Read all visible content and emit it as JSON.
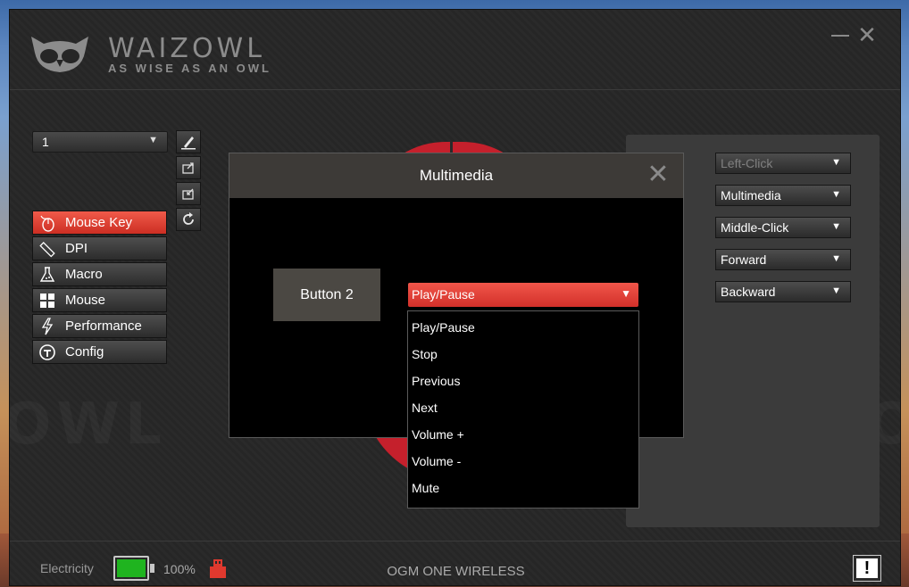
{
  "brand": {
    "name": "WAIZOWL",
    "tagline": "AS WISE AS AN OWL",
    "watermark": "OWL"
  },
  "window_controls": {
    "minimize": "minimize-icon",
    "close": "close-icon"
  },
  "profile": {
    "selected": "1"
  },
  "tools": [
    "pen-icon",
    "import-icon",
    "export-icon",
    "reset-icon"
  ],
  "nav": {
    "items": [
      {
        "label": "Mouse Key",
        "icon": "mouse-icon",
        "active": true
      },
      {
        "label": "DPI",
        "icon": "ruler-icon",
        "active": false
      },
      {
        "label": "Macro",
        "icon": "flask-icon",
        "active": false
      },
      {
        "label": "Mouse",
        "icon": "windows-icon",
        "active": false
      },
      {
        "label": "Performance",
        "icon": "lightning-icon",
        "active": false
      },
      {
        "label": "Config",
        "icon": "config-icon",
        "active": false
      }
    ]
  },
  "button_assignments": [
    {
      "value": "Left-Click",
      "disabled": true
    },
    {
      "value": "Multimedia",
      "disabled": false
    },
    {
      "value": "Middle-Click",
      "disabled": false
    },
    {
      "value": "Forward",
      "disabled": false
    },
    {
      "value": "Backward",
      "disabled": false
    }
  ],
  "modal": {
    "title": "Multimedia",
    "button_label": "Button 2",
    "selected": "Play/Pause",
    "options": [
      "Play/Pause",
      "Stop",
      "Previous",
      "Next",
      "Volume +",
      "Volume -",
      "Mute"
    ]
  },
  "footer": {
    "electricity_label": "Electricity",
    "battery_percent": "100%",
    "battery_level": 1.0,
    "device_name": "OGM ONE WIRELESS",
    "info_label": "!"
  },
  "colors": {
    "accent": "#e8433a",
    "battery": "#1fb41f",
    "panel": "#3b3b3b"
  }
}
